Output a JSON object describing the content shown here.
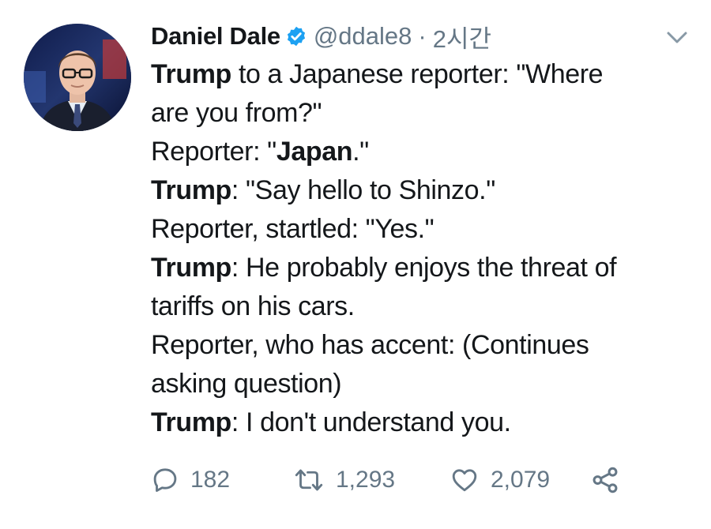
{
  "author": {
    "display_name": "Daniel Dale",
    "handle": "@ddale8",
    "separator": "·",
    "time": "2시간",
    "verified": true,
    "avatar_icon": "profile-photo"
  },
  "tweet": {
    "lines": [
      {
        "bold": "Trump",
        "text": " to a Japanese reporter: \"Where"
      },
      {
        "text": "are you from?\""
      },
      {
        "pre": "Reporter: \"",
        "bold": "Japan",
        "text": ".\""
      },
      {
        "bold": "Trump",
        "text": ": \"Say hello to Shinzo.\""
      },
      {
        "text": "Reporter, startled: \"Yes.\""
      },
      {
        "bold": "Trump",
        "text": ": He probably enjoys the threat of"
      },
      {
        "text": "tariffs on his cars."
      },
      {
        "text": "Reporter, who has accent: (Continues"
      },
      {
        "text": "asking question)"
      },
      {
        "bold": "Trump",
        "text": ": I don't understand you."
      }
    ]
  },
  "actions": {
    "replies": "182",
    "retweets": "1,293",
    "likes": "2,079"
  },
  "colors": {
    "text": "#14171a",
    "secondary": "#657786",
    "verified": "#1da1f2"
  }
}
